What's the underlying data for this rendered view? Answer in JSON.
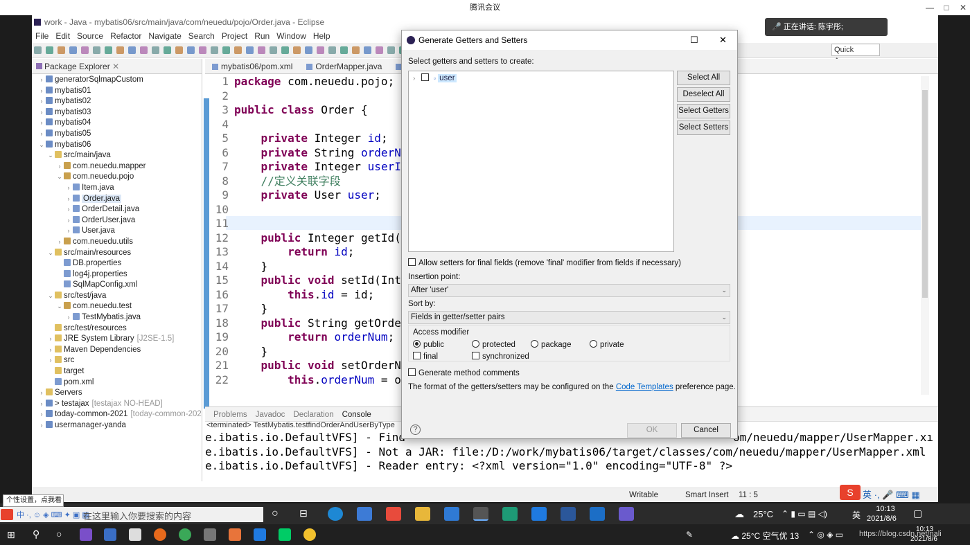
{
  "meeting": {
    "title": "腾讯会议",
    "speaking": "正在讲话: 陈宇彤;"
  },
  "eclipse": {
    "window_title": "work - Java - mybatis06/src/main/java/com/neuedu/pojo/Order.java - Eclipse",
    "menu": [
      "File",
      "Edit",
      "Source",
      "Refactor",
      "Navigate",
      "Search",
      "Project",
      "Run",
      "Window",
      "Help"
    ],
    "quick_access": "Quick Access",
    "package_explorer": {
      "title": "Package Explorer",
      "items": [
        {
          "indent": 0,
          "twisty": "›",
          "icon": "proj",
          "label": "generatorSqlmapCustom",
          "suffix": ""
        },
        {
          "indent": 0,
          "twisty": "›",
          "icon": "proj",
          "label": "mybatis01",
          "suffix": ""
        },
        {
          "indent": 0,
          "twisty": "›",
          "icon": "proj",
          "label": "mybatis02",
          "suffix": ""
        },
        {
          "indent": 0,
          "twisty": "›",
          "icon": "proj",
          "label": "mybatis03",
          "suffix": ""
        },
        {
          "indent": 0,
          "twisty": "›",
          "icon": "proj",
          "label": "mybatis04",
          "suffix": ""
        },
        {
          "indent": 0,
          "twisty": "›",
          "icon": "proj",
          "label": "mybatis05",
          "suffix": ""
        },
        {
          "indent": 0,
          "twisty": "⌄",
          "icon": "proj",
          "label": "mybatis06",
          "suffix": ""
        },
        {
          "indent": 1,
          "twisty": "⌄",
          "icon": "fold",
          "label": "src/main/java",
          "suffix": ""
        },
        {
          "indent": 2,
          "twisty": "›",
          "icon": "pkg",
          "label": "com.neuedu.mapper",
          "suffix": ""
        },
        {
          "indent": 2,
          "twisty": "⌄",
          "icon": "pkg",
          "label": "com.neuedu.pojo",
          "suffix": ""
        },
        {
          "indent": 3,
          "twisty": "›",
          "icon": "file",
          "label": "Item.java",
          "suffix": ""
        },
        {
          "indent": 3,
          "twisty": "›",
          "icon": "file",
          "label": "Order.java",
          "suffix": "",
          "selected": true
        },
        {
          "indent": 3,
          "twisty": "›",
          "icon": "file",
          "label": "OrderDetail.java",
          "suffix": ""
        },
        {
          "indent": 3,
          "twisty": "›",
          "icon": "file",
          "label": "OrderUser.java",
          "suffix": ""
        },
        {
          "indent": 3,
          "twisty": "›",
          "icon": "file",
          "label": "User.java",
          "suffix": ""
        },
        {
          "indent": 2,
          "twisty": "›",
          "icon": "pkg",
          "label": "com.neuedu.utils",
          "suffix": ""
        },
        {
          "indent": 1,
          "twisty": "⌄",
          "icon": "fold",
          "label": "src/main/resources",
          "suffix": ""
        },
        {
          "indent": 2,
          "twisty": "",
          "icon": "file",
          "label": "DB.properties",
          "suffix": ""
        },
        {
          "indent": 2,
          "twisty": "",
          "icon": "file",
          "label": "log4j.properties",
          "suffix": ""
        },
        {
          "indent": 2,
          "twisty": "",
          "icon": "file",
          "label": "SqlMapConfig.xml",
          "suffix": ""
        },
        {
          "indent": 1,
          "twisty": "⌄",
          "icon": "fold",
          "label": "src/test/java",
          "suffix": ""
        },
        {
          "indent": 2,
          "twisty": "⌄",
          "icon": "pkg",
          "label": "com.neuedu.test",
          "suffix": ""
        },
        {
          "indent": 3,
          "twisty": "›",
          "icon": "file",
          "label": "TestMybatis.java",
          "suffix": ""
        },
        {
          "indent": 1,
          "twisty": "",
          "icon": "fold",
          "label": "src/test/resources",
          "suffix": ""
        },
        {
          "indent": 1,
          "twisty": "›",
          "icon": "fold",
          "label": "JRE System Library",
          "suffix": "[J2SE-1.5]"
        },
        {
          "indent": 1,
          "twisty": "›",
          "icon": "fold",
          "label": "Maven Dependencies",
          "suffix": ""
        },
        {
          "indent": 1,
          "twisty": "›",
          "icon": "fold",
          "label": "src",
          "suffix": ""
        },
        {
          "indent": 1,
          "twisty": "",
          "icon": "fold",
          "label": "target",
          "suffix": ""
        },
        {
          "indent": 1,
          "twisty": "",
          "icon": "file",
          "label": "pom.xml",
          "suffix": ""
        },
        {
          "indent": 0,
          "twisty": "›",
          "icon": "fold",
          "label": "Servers",
          "suffix": ""
        },
        {
          "indent": 0,
          "twisty": "›",
          "icon": "proj",
          "label": "> testajax",
          "suffix": "[testajax NO-HEAD]"
        },
        {
          "indent": 0,
          "twisty": "›",
          "icon": "proj",
          "label": "today-common-2021",
          "suffix": "[today-common-202"
        },
        {
          "indent": 0,
          "twisty": "›",
          "icon": "proj",
          "label": "usermanager-yanda",
          "suffix": ""
        }
      ]
    },
    "editor_tabs": [
      "mybatis06/pom.xml",
      "OrderMapper.java",
      "Or"
    ],
    "code_lines": [
      {
        "n": "1",
        "html": "<span class=\"kw\">package</span> com.neuedu.pojo;"
      },
      {
        "n": "2",
        "html": ""
      },
      {
        "n": "3",
        "html": "<span class=\"kw\">public class</span> Order {"
      },
      {
        "n": "4",
        "html": ""
      },
      {
        "n": "5",
        "html": "    <span class=\"kw\">private</span> Integer <span class=\"fld\">id</span>;"
      },
      {
        "n": "6",
        "html": "    <span class=\"kw\">private</span> String <span class=\"fld\">orderNum</span>"
      },
      {
        "n": "7",
        "html": "    <span class=\"kw\">private</span> Integer <span class=\"fld\">userId</span>"
      },
      {
        "n": "8",
        "html": "    <span class=\"cmt\">//定义关联字段</span>"
      },
      {
        "n": "9",
        "html": "    <span class=\"kw\">private</span> User <span class=\"fld\">user</span>;"
      },
      {
        "n": "10",
        "html": ""
      },
      {
        "n": "11",
        "html": ""
      },
      {
        "n": "12",
        "html": "    <span class=\"kw\">public</span> Integer getId()"
      },
      {
        "n": "13",
        "html": "        <span class=\"kw\">return</span> <span class=\"fld\">id</span>;"
      },
      {
        "n": "14",
        "html": "    }"
      },
      {
        "n": "15",
        "html": "    <span class=\"kw\">public void</span> setId(Inte"
      },
      {
        "n": "16",
        "html": "        <span class=\"kw\">this</span>.<span class=\"fld\">id</span> = id;"
      },
      {
        "n": "17",
        "html": "    }"
      },
      {
        "n": "18",
        "html": "    <span class=\"kw\">public</span> String getOrder"
      },
      {
        "n": "19",
        "html": "        <span class=\"kw\">return</span> <span class=\"fld\">orderNum</span>;"
      },
      {
        "n": "20",
        "html": "    }"
      },
      {
        "n": "21",
        "html": "    <span class=\"kw\">public void</span> setOrderNu"
      },
      {
        "n": "22",
        "html": "        <span class=\"kw\">this</span>.<span class=\"fld\">orderNum</span> = or"
      }
    ],
    "bottom_tabs": [
      "Problems",
      "Javadoc",
      "Declaration",
      "Console"
    ],
    "console_header": "<terminated> TestMybatis.testfindOrderAndUserByType",
    "console_lines": [
      "e.ibatis.io.DefaultVFS] - Find",
      "e.ibatis.io.DefaultVFS] - Not a JAR: file:/D:/work/mybatis06/target/classes/com/neuedu/mapper/UserMapper.xml",
      "e.ibatis.io.DefaultVFS] - Reader entry: <?xml version=\"1.0\" encoding=\"UTF-8\" ?>"
    ],
    "console_right": "om/neuedu/mapper/UserMapper.xı",
    "status": {
      "writable": "Writable",
      "insert": "Smart Insert",
      "pos": "11 : 5"
    }
  },
  "dialog": {
    "title": "Generate Getters and Setters",
    "prompt": "Select getters and setters to create:",
    "field": "user",
    "buttons": {
      "select_all": "Select All",
      "deselect_all": "Deselect All",
      "select_getters": "Select Getters",
      "select_setters": "Select Setters",
      "ok": "OK",
      "cancel": "Cancel"
    },
    "allow_final": "Allow setters for final fields (remove 'final' modifier from fields if necessary)",
    "insertion_label": "Insertion point:",
    "insertion_value": "After 'user'",
    "sort_label": "Sort by:",
    "sort_value": "Fields in getter/setter pairs",
    "access_label": "Access modifier",
    "access": [
      "public",
      "protected",
      "package",
      "private"
    ],
    "final_label": "final",
    "sync_label": "synchronized",
    "gen_comments": "Generate method comments",
    "footer_pre": "The format of the getters/setters may be configured on the",
    "footer_link": "Code Templates",
    "footer_post": "preference page."
  },
  "taskbar": {
    "tooltip": "个性设置，点我看看",
    "search_placeholder": "在这里输入你要搜索的内容",
    "temp": "25°C",
    "ime": "英",
    "time": "10:13",
    "date": "2021/8/6",
    "weather": "25°C 空气优 13",
    "watermark": "https://blog.csdn.net/nali",
    "time2": "10:13",
    "date2": "2021/8/6"
  }
}
